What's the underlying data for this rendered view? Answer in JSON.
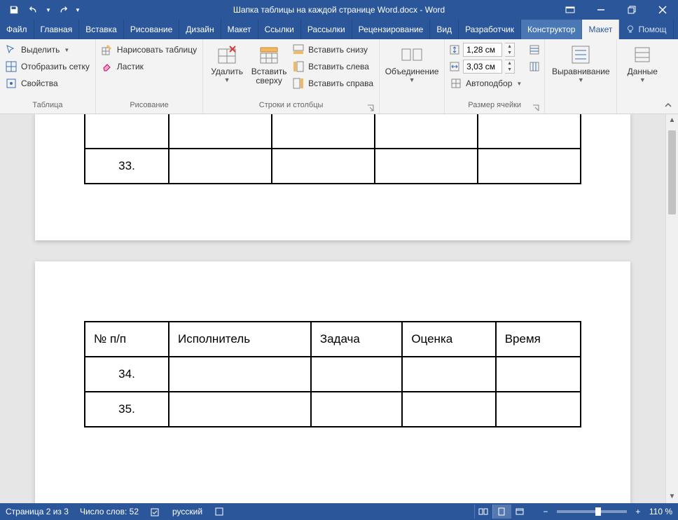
{
  "title": "Шапка таблицы на каждой странице Word.docx - Word",
  "qat": {
    "save": "save",
    "undo": "undo",
    "redo": "redo"
  },
  "window": {
    "ribbon_opts": "",
    "min": "",
    "restore": "",
    "close": ""
  },
  "tabs": {
    "file": "Файл",
    "home": "Главная",
    "insert": "Вставка",
    "drawing": "Рисование",
    "design": "Дизайн",
    "layout_page": "Макет",
    "references": "Ссылки",
    "mailings": "Рассылки",
    "review": "Рецензирование",
    "view": "Вид",
    "developer": "Разработчик",
    "constructor": "Конструктор",
    "layout": "Макет",
    "help": "Помощ"
  },
  "ribbon": {
    "table": {
      "label": "Таблица",
      "select": "Выделить",
      "gridlines": "Отобразить сетку",
      "properties": "Свойства"
    },
    "draw": {
      "label": "Рисование",
      "draw_table": "Нарисовать таблицу",
      "eraser": "Ластик"
    },
    "rowscols": {
      "label": "Строки и столбцы",
      "delete": "Удалить",
      "insert_above": "Вставить сверху",
      "insert_below": "Вставить снизу",
      "insert_left": "Вставить слева",
      "insert_right": "Вставить справа"
    },
    "merge": {
      "label": "Объединение"
    },
    "cellsize": {
      "label": "Размер ячейки",
      "height": "1,28 см",
      "width": "3,03 см",
      "autofit": "Автоподбор"
    },
    "alignment": {
      "label": "Выравнивание"
    },
    "data": {
      "label": "Данные"
    }
  },
  "doc": {
    "page1": {
      "rows": [
        {
          "num": "33."
        }
      ]
    },
    "page2": {
      "headers": [
        "№ п/п",
        "Исполнитель",
        "Задача",
        "Оценка",
        "Время"
      ],
      "rows": [
        {
          "num": "34."
        },
        {
          "num": "35."
        }
      ]
    }
  },
  "status": {
    "page": "Страница 2 из 3",
    "words": "Число слов: 52",
    "lang": "русский",
    "zoom": "110 %"
  }
}
